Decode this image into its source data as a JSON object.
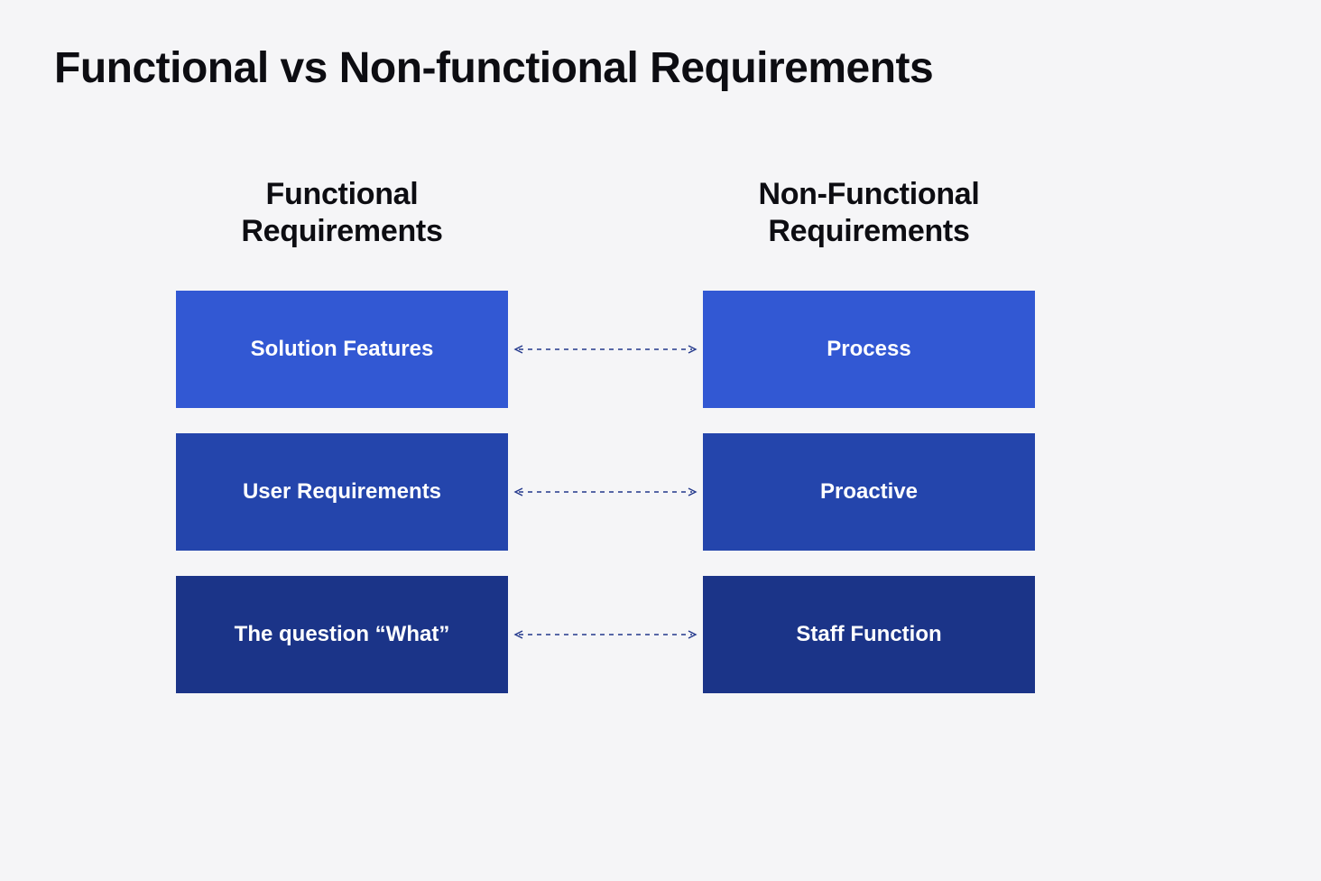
{
  "title": "Functional vs Non-functional Requirements",
  "columns": {
    "left": "Functional Requirements",
    "right": "Non-Functional Requirements"
  },
  "rows": [
    {
      "left": "Solution Features",
      "right": "Process",
      "shade": "shade-1"
    },
    {
      "left": "User Requirements",
      "right": "Proactive",
      "shade": "shade-2"
    },
    {
      "left": "The question “What”",
      "right": "Staff Function",
      "shade": "shade-3"
    }
  ],
  "colors": {
    "row1": "#3258d3",
    "row2": "#2445ac",
    "row3": "#1b3488",
    "connector": "#23388c"
  }
}
